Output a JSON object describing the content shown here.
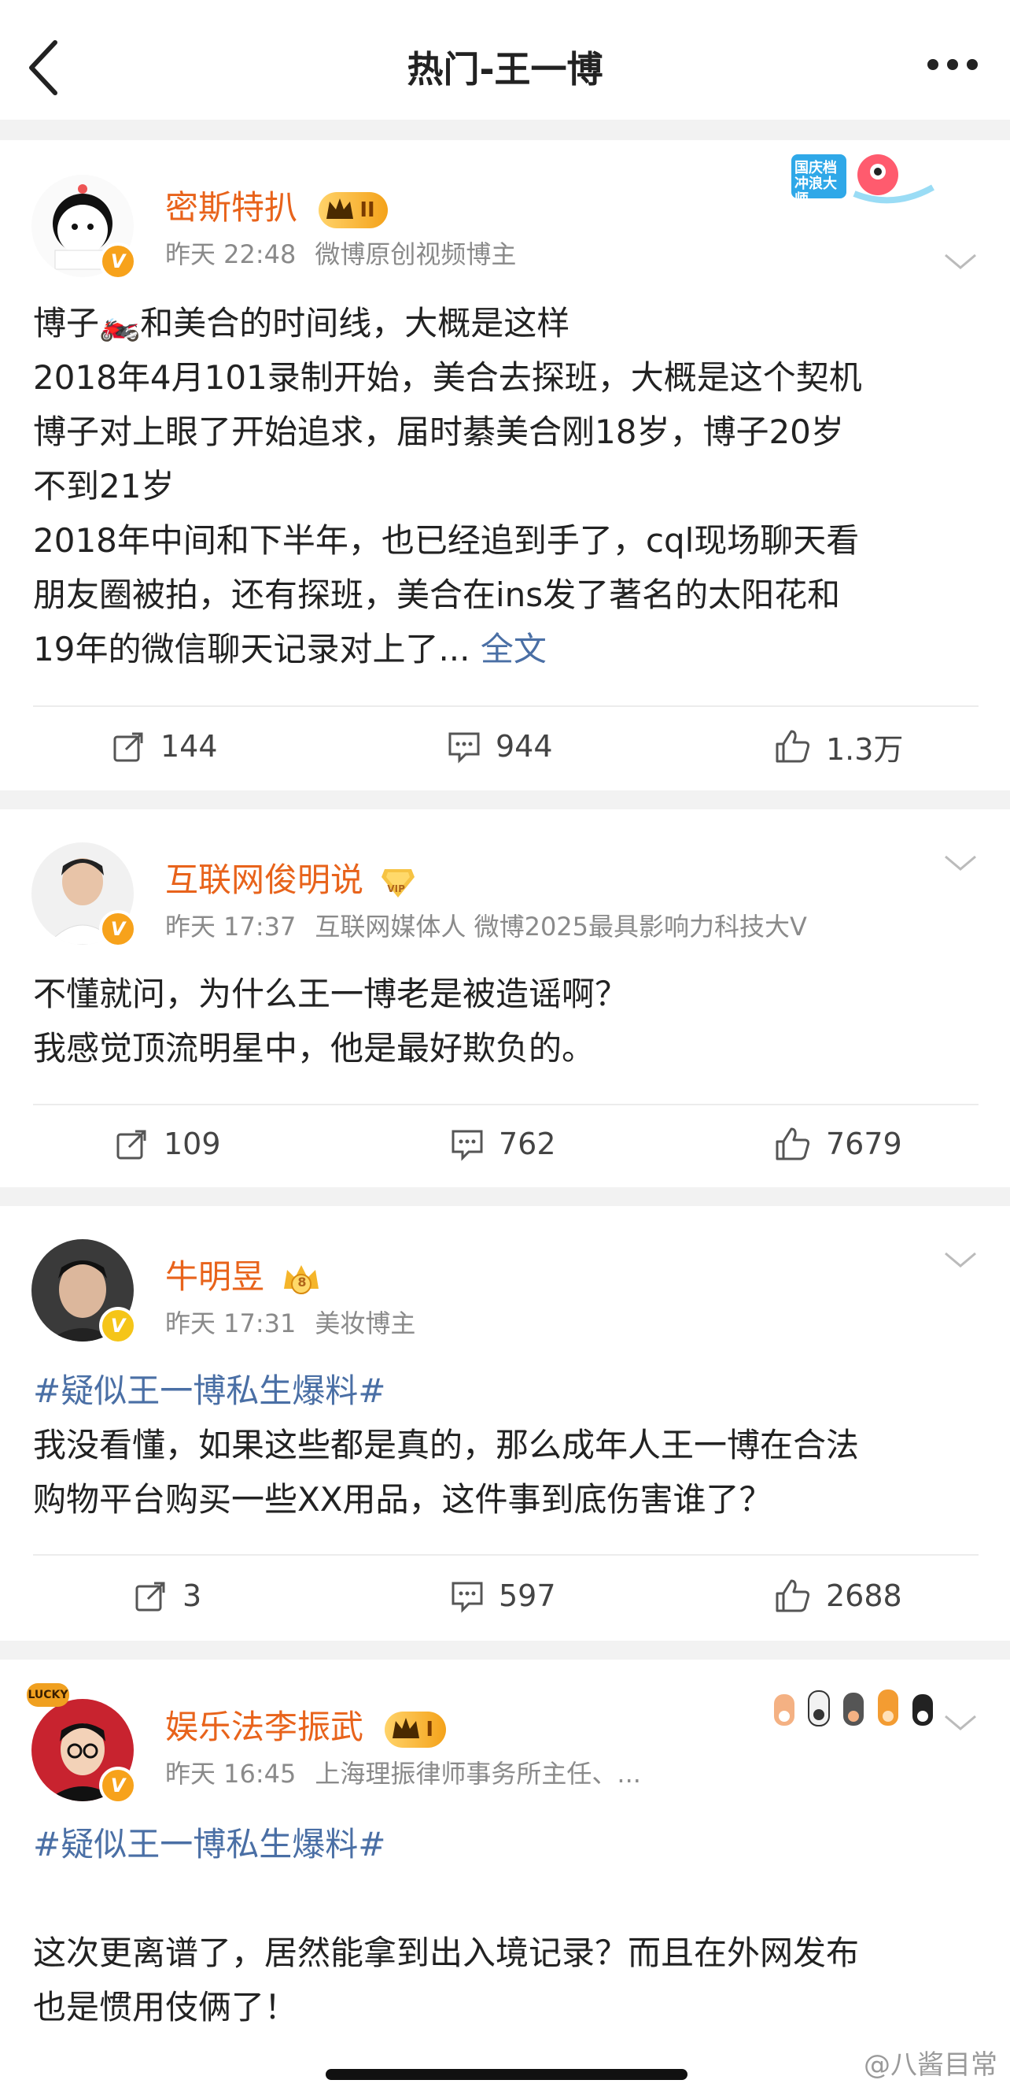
{
  "header": {
    "title": "热门-王一博",
    "back_icon": "chevron-left-icon",
    "more_icon": "more-horizontal-icon"
  },
  "posts": [
    {
      "username": "密斯特扒",
      "rank_label": "II",
      "time": "昨天 22:48",
      "desc": "微博原创视频博主",
      "content_lines": [
        "博子🏍️和美合的时间线，大概是这样",
        "2018年4月101录制开始，美合去探班，大概是这个契机",
        "博子对上眼了开始追求，届时綦美合刚18岁，博子20岁",
        "不到21岁",
        "2018年中间和下半年，也已经追到手了，cql现场聊天看",
        "朋友圈被拍，还有探班，美合在ins发了著名的太阳花和",
        "19年的微信聊天记录对上了..."
      ],
      "more_link": "全文",
      "reposts": "144",
      "comments": "944",
      "likes": "1.3万",
      "decor_text": "国庆档 冲浪大师"
    },
    {
      "username": "互联网俊明说",
      "rank_label": "VIP",
      "time": "昨天 17:37",
      "desc": "互联网媒体人 微博2025最具影响力科技大V",
      "content_lines": [
        "不懂就问，为什么王一博老是被造谣啊？",
        "我感觉顶流明星中，他是最好欺负的。"
      ],
      "reposts": "109",
      "comments": "762",
      "likes": "7679"
    },
    {
      "username": "牛明昱",
      "rank_label": "8",
      "time": "昨天 17:31",
      "desc": "美妆博主",
      "hashtag": "#疑似王一博私生爆料#",
      "content_lines": [
        "我没看懂，如果这些都是真的，那么成年人王一博在合法",
        "购物平台购买一些XX用品，这件事到底伤害谁了？"
      ],
      "reposts": "3",
      "comments": "597",
      "likes": "2688"
    },
    {
      "username": "娱乐法李振武",
      "rank_label": "I",
      "time": "昨天 16:45",
      "desc": "上海理振律师事务所主任、...",
      "hashtag": "#疑似王一博私生爆料#",
      "avatar_badge": "LUCKY",
      "content_lines": [
        "这次更离谱了，居然能拿到出入境记录？而且在外网发布",
        "也是惯用伎俩了！"
      ]
    }
  ],
  "watermark": "@八酱目常",
  "colors": {
    "username": "#e8631b",
    "link": "#4a6fa5",
    "meta": "#8a8a8a",
    "separator": "#f2f2f2",
    "badge": "#f7a21b"
  }
}
